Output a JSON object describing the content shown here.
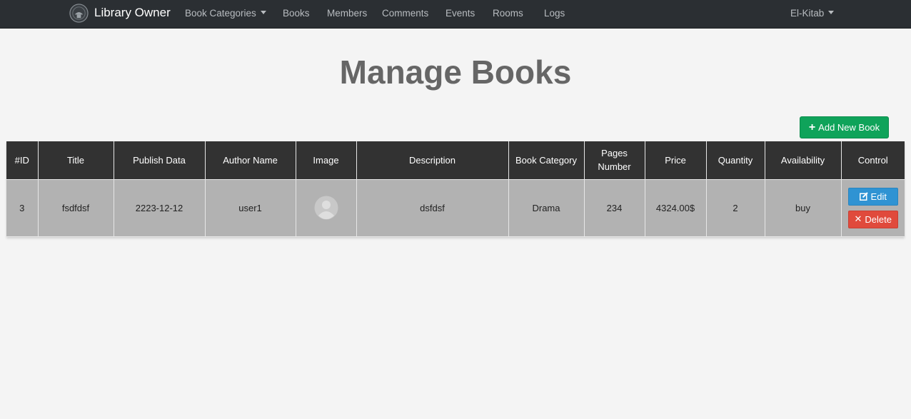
{
  "nav": {
    "brand": "Library Owner",
    "items": [
      {
        "label": "Book Categories",
        "dropdown": true
      },
      {
        "label": "Books"
      },
      {
        "label": "Members"
      },
      {
        "label": "Comments"
      },
      {
        "label": "Events"
      },
      {
        "label": "Rooms"
      },
      {
        "label": "Logs"
      }
    ],
    "user_menu": "El-Kitab"
  },
  "page": {
    "title": "Manage Books",
    "add_button": "Add New Book"
  },
  "table": {
    "headers": [
      "#ID",
      "Title",
      "Publish Data",
      "Author Name",
      "Image",
      "Description",
      "Book Category",
      "Pages Number",
      "Price",
      "Quantity",
      "Availability",
      "Control"
    ],
    "rows": [
      {
        "id": "3",
        "title": "fsdfdsf",
        "publish_date": "2223-12-12",
        "author": "user1",
        "image_icon": "user-avatar-placeholder-icon",
        "description": "dsfdsf",
        "category": "Drama",
        "pages": "234",
        "price": "4324.00$",
        "quantity": "2",
        "availability": "buy",
        "edit_label": "Edit",
        "delete_label": "Delete"
      }
    ]
  },
  "colors": {
    "navbar": "#2b2f33",
    "table_header": "#323232",
    "row": "#b2b2b2",
    "add": "#0fa35a",
    "edit": "#2f93d3",
    "delete": "#e04a3c"
  }
}
